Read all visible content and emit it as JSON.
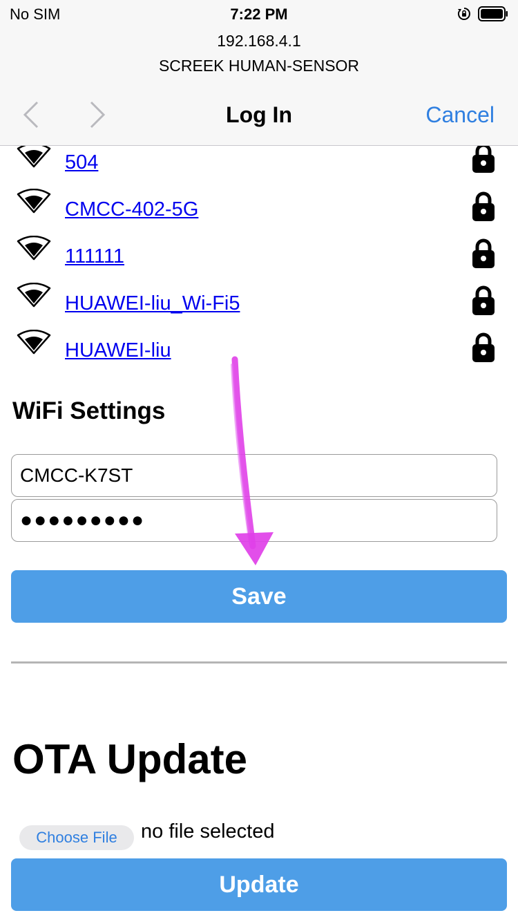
{
  "status_bar": {
    "carrier": "No SIM",
    "time": "7:22 PM",
    "icons": [
      "orientation-lock-icon",
      "battery-icon"
    ]
  },
  "header": {
    "host": "192.168.4.1",
    "subtitle": "SCREEK HUMAN-SENSOR",
    "title": "Log In",
    "cancel_label": "Cancel"
  },
  "networks": [
    {
      "ssid": "504",
      "secured": true
    },
    {
      "ssid": "CMCC-402-5G",
      "secured": true
    },
    {
      "ssid": "111111",
      "secured": true
    },
    {
      "ssid": "HUAWEI-liu_Wi-Fi5",
      "secured": true
    },
    {
      "ssid": "HUAWEI-liu",
      "secured": true
    }
  ],
  "wifi_settings": {
    "title": "WiFi Settings",
    "ssid_value": "CMCC-K7ST",
    "password_value": "●●●●●●●●●",
    "save_label": "Save"
  },
  "ota": {
    "title": "OTA Update",
    "choose_file_label": "Choose File",
    "file_status": "no file selected",
    "update_label": "Update"
  },
  "colors": {
    "accent": "#2f7fe0",
    "button": "#4e9ee7",
    "link": "#0000ee",
    "annotation_arrow": "#e040e8"
  }
}
